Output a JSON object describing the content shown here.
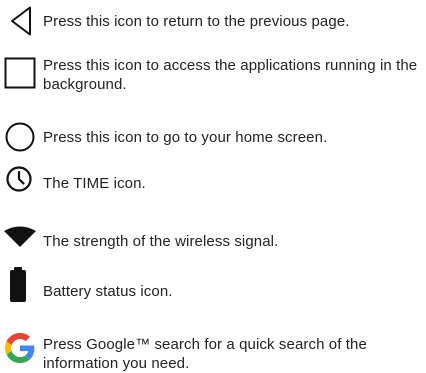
{
  "items": [
    {
      "icon": "back-triangle-icon",
      "text": "Press this icon to return to the previous page."
    },
    {
      "icon": "recent-apps-square-icon",
      "text": "Press this icon to access the applications running in the background."
    },
    {
      "icon": "home-circle-icon",
      "text": "Press this icon to go to your home screen."
    },
    {
      "icon": "clock-icon",
      "text": "The TIME icon."
    },
    {
      "icon": "wifi-signal-icon",
      "text": "The strength of the wireless signal."
    },
    {
      "icon": "battery-icon",
      "text": "Battery status icon."
    },
    {
      "icon": "google-g-icon",
      "text": "Press Google™ search for a quick search of the information you need."
    }
  ],
  "colors": {
    "text": "#222222",
    "icon": "#111111",
    "google_blue": "#4285F4",
    "google_red": "#EA4335",
    "google_yellow": "#FBBC05",
    "google_green": "#34A853"
  }
}
